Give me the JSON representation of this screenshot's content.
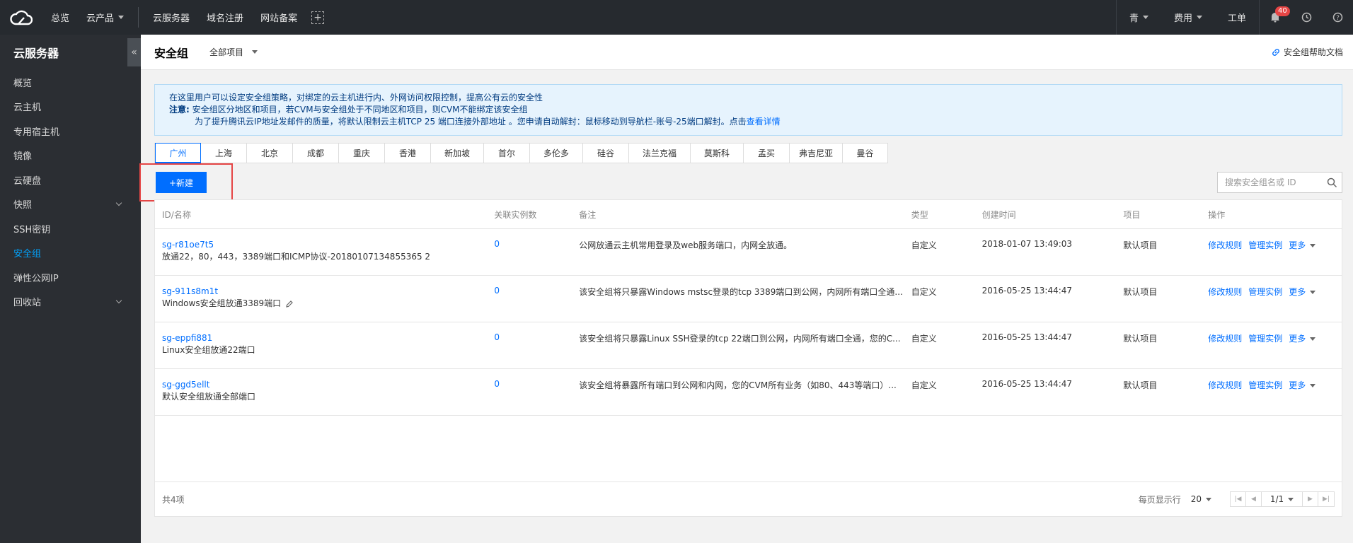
{
  "topbar": {
    "logo_icon": "cloud-logo-icon",
    "nav": [
      "总览",
      "云产品"
    ],
    "quick": [
      "云服务器",
      "域名注册",
      "网站备案"
    ],
    "user": "青",
    "billing": "费用",
    "ticket": "工单",
    "notify_count": "40"
  },
  "sidebar": {
    "title": "云服务器",
    "items": [
      {
        "label": "概览"
      },
      {
        "label": "云主机"
      },
      {
        "label": "专用宿主机"
      },
      {
        "label": "镜像"
      },
      {
        "label": "云硬盘"
      },
      {
        "label": "快照"
      },
      {
        "label": "SSH密钥"
      },
      {
        "label": "安全组"
      },
      {
        "label": "弹性公网IP"
      },
      {
        "label": "回收站"
      }
    ]
  },
  "header": {
    "title": "安全组",
    "project": "全部项目",
    "help": "安全组帮助文档"
  },
  "notice": {
    "line1": "在这里用户可以设定安全组策略，对绑定的云主机进行内、外网访问权限控制，提高公有云的安全性",
    "note_label": "注意:",
    "line2": "安全组区分地区和项目，若CVM与安全组处于不同地区和项目，则CVM不能绑定该安全组",
    "line3": "为了提升腾讯云IP地址发邮件的质量，将默认限制云主机TCP 25 端口连接外部地址 。您申请自动解封：鼠标移动到导航栏-账号-25端口解封。点击",
    "link": "查看详情"
  },
  "regions": [
    "广州",
    "上海",
    "北京",
    "成都",
    "重庆",
    "香港",
    "新加坡",
    "首尔",
    "多伦多",
    "硅谷",
    "法兰克福",
    "莫斯科",
    "孟买",
    "弗吉尼亚",
    "曼谷"
  ],
  "toolbar": {
    "new_label": "+新建",
    "search_placeholder": "搜索安全组名或 ID"
  },
  "table": {
    "headers": [
      "ID/名称",
      "关联实例数",
      "备注",
      "类型",
      "创建时间",
      "项目",
      "操作"
    ],
    "rows": [
      {
        "id": "sg-r81oe7t5",
        "name": "放通22，80，443，3389端口和ICMP协议-20180107134855365 2",
        "count": "0",
        "note": "公网放通云主机常用登录及web服务端口，内网全放通。",
        "type": "自定义",
        "time": "2018-01-07 13:49:03",
        "project": "默认项目"
      },
      {
        "id": "sg-911s8m1t",
        "name": "Windows安全组放通3389端口",
        "count": "0",
        "note": "该安全组将只暴露Windows mstsc登录的tcp 3389端口到公网，内网所有端口全通...",
        "type": "自定义",
        "time": "2016-05-25 13:44:47",
        "project": "默认项目"
      },
      {
        "id": "sg-eppfi881",
        "name": "Linux安全组放通22端口",
        "count": "0",
        "note": "该安全组将只暴露Linux SSH登录的tcp 22端口到公网，内网所有端口全通，您的C...",
        "type": "自定义",
        "time": "2016-05-25 13:44:47",
        "project": "默认项目"
      },
      {
        "id": "sg-ggd5ellt",
        "name": "默认安全组放通全部端口",
        "count": "0",
        "note": "该安全组将暴露所有端口到公网和内网，您的CVM所有业务（如80、443等端口）...",
        "type": "自定义",
        "time": "2016-05-25 13:44:47",
        "project": "默认项目"
      }
    ],
    "op_edit": "修改规则",
    "op_manage": "管理实例",
    "op_more": "更多"
  },
  "footer": {
    "total": "共4项",
    "per_page_label": "每页显示行",
    "page_size": "20",
    "page": "1/1"
  }
}
